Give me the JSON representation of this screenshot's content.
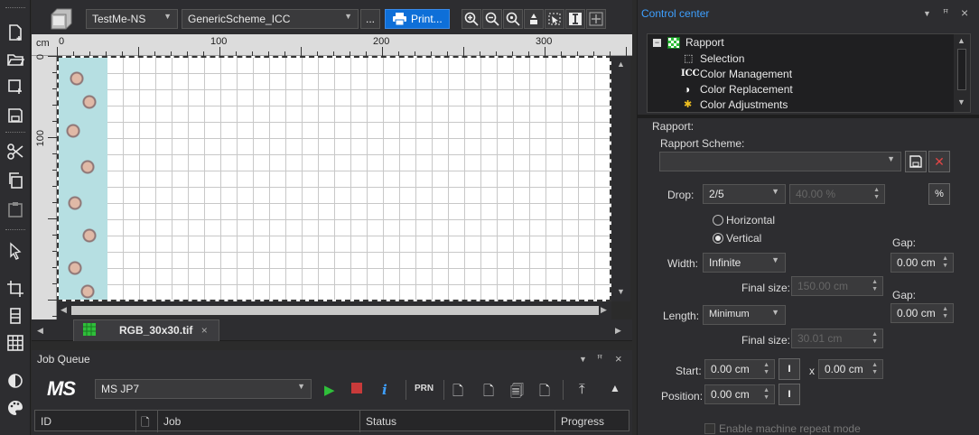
{
  "toolbar": {
    "profile": "TestMe-NS",
    "scheme": "GenericScheme_ICC",
    "ellipsis": "...",
    "print_label": "Print..."
  },
  "ruler": {
    "unit": "cm",
    "top_ticks": [
      "0",
      "100",
      "200",
      "300"
    ],
    "left_ticks": [
      "0",
      "100"
    ]
  },
  "document_tab": {
    "label": "RGB_30x30.tif",
    "close": "×"
  },
  "job_queue": {
    "title": "Job Queue",
    "logo": "MS",
    "printer": "MS JP7",
    "prn_label": "PRN",
    "columns": [
      "ID",
      "Job",
      "Status",
      "Progress"
    ]
  },
  "control_center": {
    "title": "Control center",
    "tree": [
      {
        "label": "Rapport",
        "icon": "rapport-icon"
      },
      {
        "label": "Selection",
        "icon": "selection-icon"
      },
      {
        "label": "Color Management",
        "icon": "icc-icon"
      },
      {
        "label": "Color Replacement",
        "icon": "half-circle-icon"
      },
      {
        "label": "Color Adjustments",
        "icon": "adjust-icon"
      }
    ],
    "icc_glyph": "ICC",
    "rapport": {
      "section_label": "Rapport:",
      "scheme_label": "Rapport Scheme:",
      "scheme_value": "",
      "drop_label": "Drop:",
      "drop_value": "2/5",
      "drop_percent": "40.00 %",
      "percent_button": "%",
      "horizontal_label": "Horizontal",
      "vertical_label": "Vertical",
      "orientation_selected": "Vertical",
      "width_label": "Width:",
      "width_value": "Infinite",
      "gap_label_1": "Gap:",
      "gap_value_1": "0.00 cm",
      "final_size_label_1": "Final size:",
      "final_size_1": "150.00 cm",
      "length_label": "Length:",
      "length_value": "Minimum",
      "gap_label_2": "Gap:",
      "gap_value_2": "0.00 cm",
      "final_size_label_2": "Final size:",
      "final_size_2": "30.01 cm",
      "start_label": "Start:",
      "start_x": "0.00 cm",
      "x_label": "x",
      "start_y": "0.00 cm",
      "position_label": "Position:",
      "position_value": "0.00 cm",
      "machine_repeat_label": "Enable machine repeat mode"
    }
  },
  "colors": {
    "accent": "#0e6fd8",
    "title_blue": "#3ea0ff",
    "tile_bg": "#b6dfe2",
    "stop_red": "#c83a3a",
    "play_green": "#2fbf3a"
  }
}
